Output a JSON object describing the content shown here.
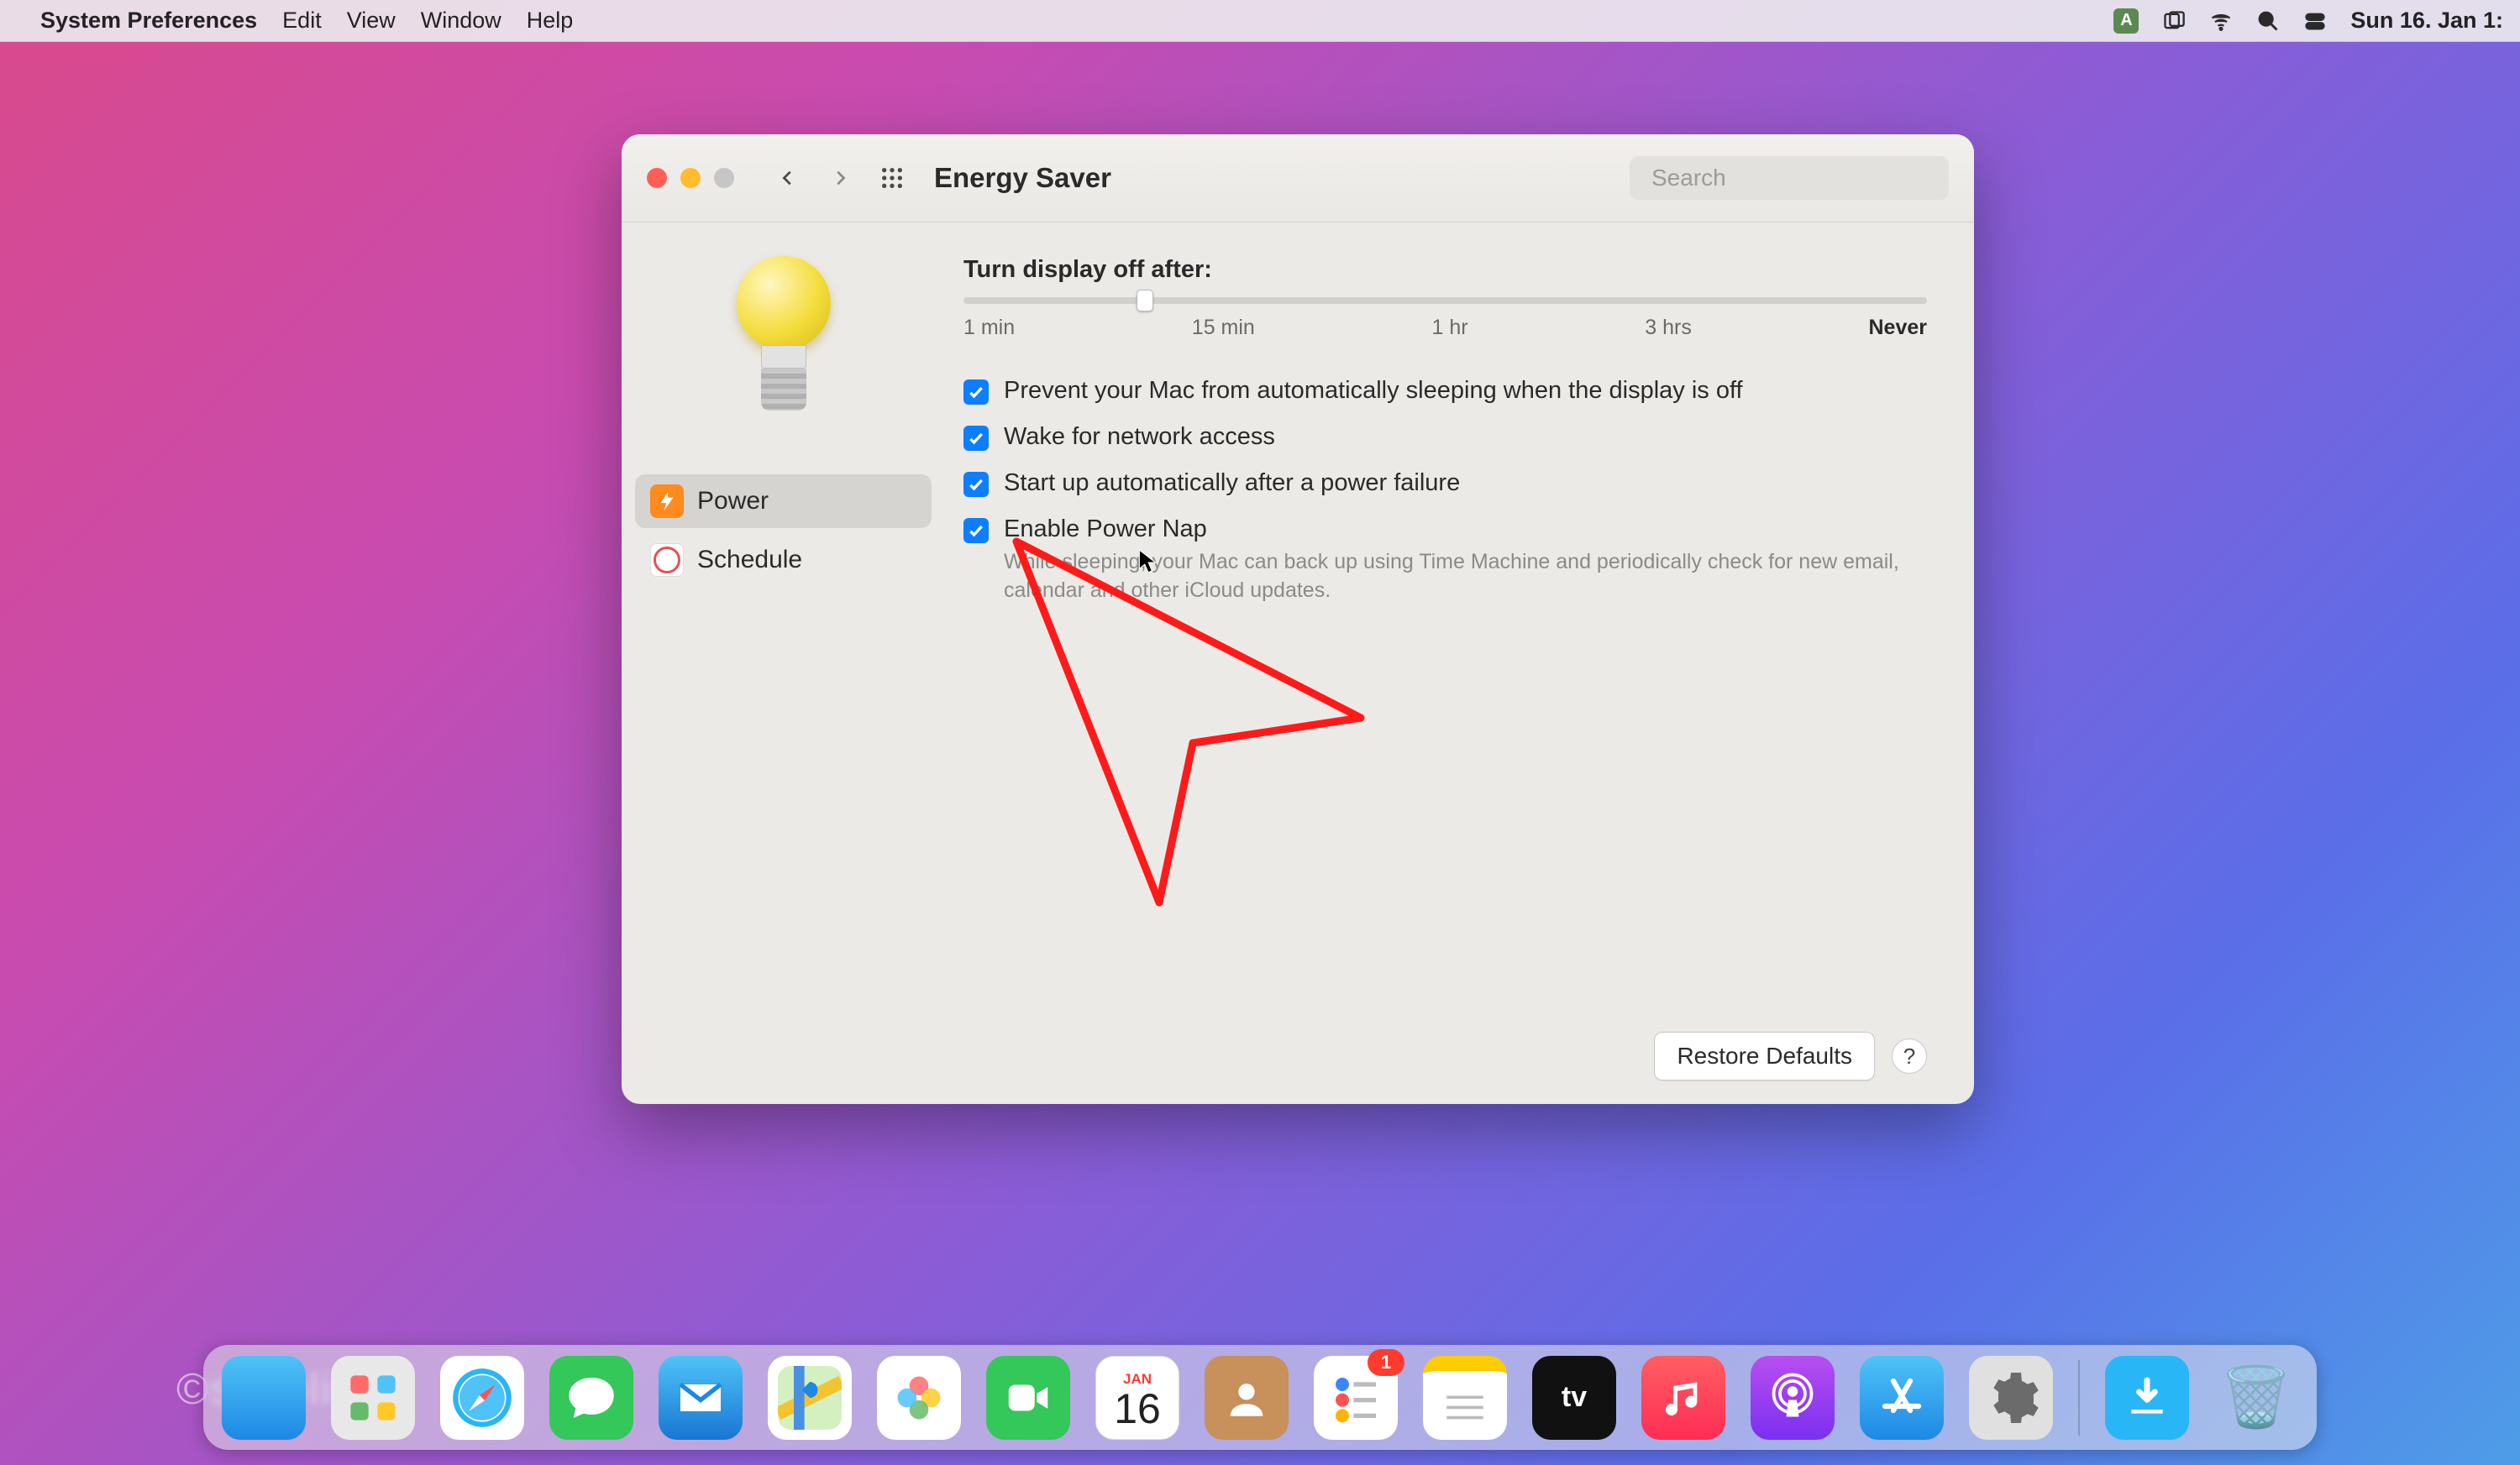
{
  "menubar": {
    "app_name": "System Preferences",
    "items": [
      "Edit",
      "View",
      "Window",
      "Help"
    ],
    "lang_indicator": "A",
    "clock": "Sun 16. Jan  1:"
  },
  "window": {
    "title": "Energy Saver",
    "search_placeholder": "Search",
    "sidebar": {
      "items": [
        {
          "label": "Power",
          "active": true
        },
        {
          "label": "Schedule",
          "active": false
        }
      ]
    },
    "slider": {
      "heading": "Turn display off after:",
      "ticks": [
        "1 min",
        "15 min",
        "1 hr",
        "3 hrs",
        "Never"
      ],
      "thumb_pct": 18
    },
    "options": [
      {
        "label": "Prevent your Mac from automatically sleeping when the display is off",
        "checked": true
      },
      {
        "label": "Wake for network access",
        "checked": true
      },
      {
        "label": "Start up automatically after a power failure",
        "checked": true
      },
      {
        "label": "Enable Power Nap",
        "checked": true,
        "sub": "While sleeping, your Mac can back up using Time Machine and periodically check for new email, calendar and other iCloud updates."
      }
    ],
    "restore_label": "Restore Defaults",
    "help_label": "?"
  },
  "dock": {
    "calendar": {
      "month": "JAN",
      "day": "16"
    },
    "reminders_badge": "1",
    "tv_label": "tv"
  },
  "watermark": "©simpligo"
}
